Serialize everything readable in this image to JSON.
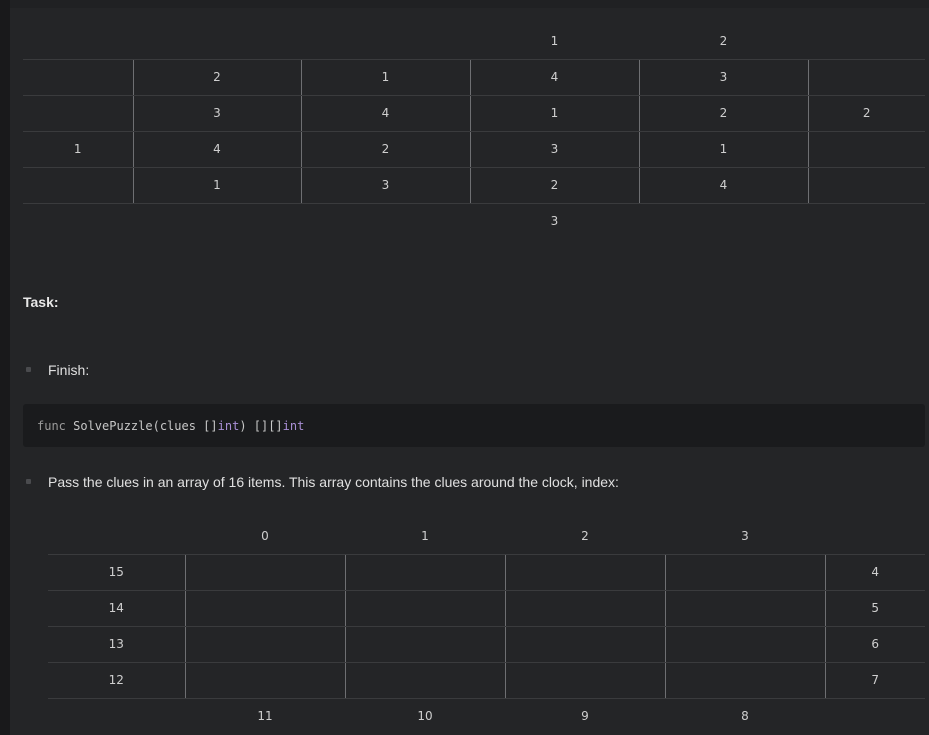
{
  "example_grid": {
    "top_clues": [
      "",
      "",
      "",
      "1",
      "2",
      ""
    ],
    "rows": [
      {
        "left": "",
        "cells": [
          "2",
          "1",
          "4",
          "3"
        ],
        "right": ""
      },
      {
        "left": "",
        "cells": [
          "3",
          "4",
          "1",
          "2"
        ],
        "right": "2"
      },
      {
        "left": "1",
        "cells": [
          "4",
          "2",
          "3",
          "1"
        ],
        "right": ""
      },
      {
        "left": "",
        "cells": [
          "1",
          "3",
          "2",
          "4"
        ],
        "right": ""
      }
    ],
    "bottom_clues": [
      "",
      "",
      "",
      "3",
      "",
      ""
    ]
  },
  "task_heading": "Task:",
  "bullet_finish": "Finish:",
  "code": {
    "func_kw": "func",
    "sig_a": " SolvePuzzle(clues []",
    "int1": "int",
    "sig_b": ") [][]",
    "int2": "int"
  },
  "bullet_pass": "Pass the clues in an array of 16 items. This array contains the clues around the clock, index:",
  "index_grid": {
    "top": [
      "",
      "0",
      "1",
      "2",
      "3",
      ""
    ],
    "rows": [
      {
        "left": "15",
        "right": "4"
      },
      {
        "left": "14",
        "right": "5"
      },
      {
        "left": "13",
        "right": "6"
      },
      {
        "left": "12",
        "right": "7"
      }
    ],
    "bottom": [
      "",
      "11",
      "10",
      "9",
      "8",
      ""
    ]
  }
}
